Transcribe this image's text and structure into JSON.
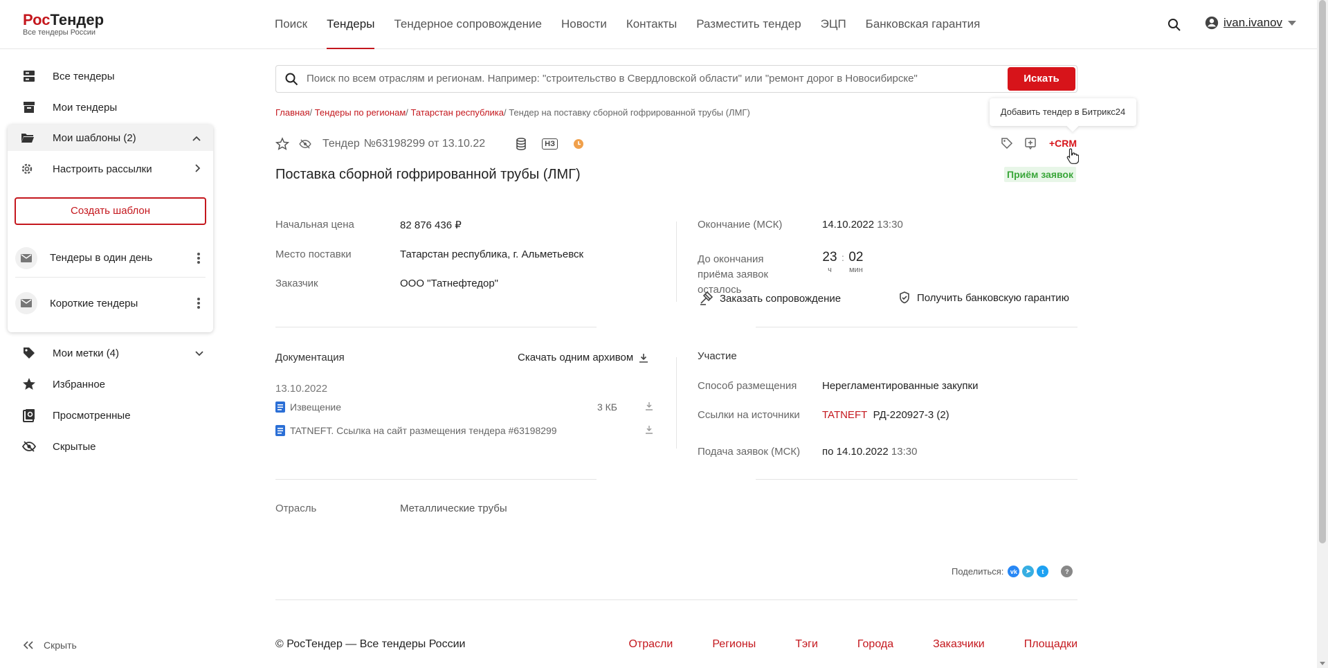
{
  "logo": {
    "brand_a": "Рос",
    "brand_b": "Тендер",
    "tagline": "Все тендеры России"
  },
  "nav": [
    "Поиск",
    "Тендеры",
    "Тендерное сопровождение",
    "Новости",
    "Контакты",
    "Разместить тендер",
    "ЭЦП",
    "Банковская гарантия"
  ],
  "nav_active": "Тендеры",
  "user": {
    "name": "ivan.ivanov"
  },
  "sidebar": {
    "all_tenders": "Все тендеры",
    "my_tenders": "Мои тендеры",
    "templates": "Мои шаблоны (2)",
    "mailing": "Настроить рассылки",
    "create_template": "Создать шаблон",
    "template_items": [
      "Тендеры в один день",
      "Короткие тендеры"
    ],
    "tags": "Мои метки (4)",
    "favorites": "Избранное",
    "viewed": "Просмотренные",
    "hidden": "Скрытые",
    "hide": "Скрыть"
  },
  "search": {
    "placeholder": "Поиск по всем отраслям и регионам. Например: \"строительство в Свердловской области\" или \"ремонт дорог в Новосибирске\"",
    "button": "Искать"
  },
  "breadcrumbs": {
    "items": [
      "Главная",
      "Тендеры по регионам",
      "Татарстан республика"
    ],
    "current": "Тендер на поставку сборной гофрированной трубы (ЛМГ)"
  },
  "tooltip": "Добавить тендер в Битрикс24",
  "tender": {
    "label": "Тендер",
    "number": "№63198299 от 13.10.22",
    "badge": "НЗ",
    "crm": "+CRM",
    "title": "Поставка сборной гофрированной трубы (ЛМГ)",
    "status": "Приём заявок",
    "start_price_label": "Начальная цена",
    "start_price": "82 876 436 ₽",
    "place_label": "Место поставки",
    "place": "Татарстан республика, г. Альметьевск",
    "customer_label": "Заказчик",
    "customer": "ООО \"Татнефтедор\"",
    "end_label": "Окончание (МСК)",
    "end_date": "14.10.2022",
    "end_time": "13:30",
    "remaining_label": "До окончания приёма заявок осталось",
    "hours": "23",
    "hours_unit": "ч",
    "minutes": "02",
    "minutes_unit": "мин",
    "order_support": "Заказать сопровождение",
    "bank_guarantee": "Получить банковскую гарантию"
  },
  "documents": {
    "title": "Документация",
    "download_all": "Скачать одним архивом",
    "date": "13.10.2022",
    "files": [
      {
        "name": "Извещение",
        "size": "3 КБ"
      },
      {
        "name": "TATNEFT. Ссылка на сайт размещения тендера #63198299",
        "size": ""
      }
    ]
  },
  "participation": {
    "title": "Участие",
    "method_label": "Способ размещения",
    "method": "Нерегламентированные закупки",
    "sources_label": "Ссылки на источники",
    "source_link": "TATNEFT",
    "source_code": "РД-220927-3 (2)",
    "submit_label": "Подача заявок (МСК)",
    "submit_date": "по 14.10.2022",
    "submit_time": "13:30"
  },
  "industry": {
    "label": "Отрасль",
    "value": "Металлические трубы"
  },
  "share": {
    "label": "Поделиться:"
  },
  "footer": {
    "copy": "© РосТендер — Все тендеры России",
    "links": [
      "Отрасли",
      "Регионы",
      "Тэги",
      "Города",
      "Заказчики",
      "Площадки"
    ]
  },
  "colors": {
    "brand": "#c4171d",
    "button": "#d7141a",
    "status_green": "#3aa63a"
  }
}
